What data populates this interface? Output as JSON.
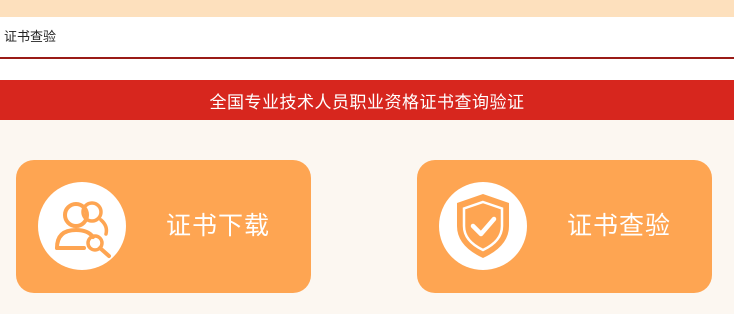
{
  "nav": {
    "title": "证书查验"
  },
  "banner": {
    "title": "全国专业技术人员职业资格证书查询验证"
  },
  "cards": [
    {
      "label": "证书下载",
      "icon": "user-search-icon"
    },
    {
      "label": "证书查验",
      "icon": "shield-check-icon"
    }
  ],
  "colors": {
    "top_strip": "#fde0bd",
    "nav_border": "#9a1b16",
    "banner": "#d7261e",
    "content_bg": "#fcf7f1",
    "card": "#fea552"
  }
}
